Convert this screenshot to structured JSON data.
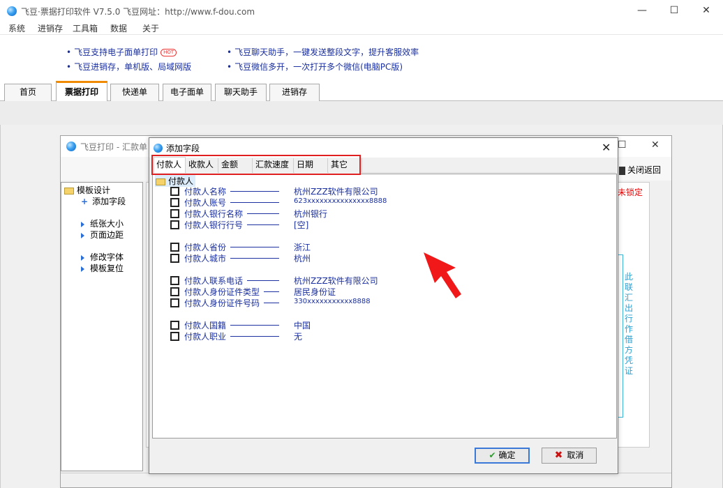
{
  "window": {
    "title": "飞豆·票据打印软件 V7.5.0   飞豆网址：http://www.f-dou.com",
    "controls": {
      "minimize": "—",
      "maximize": "☐",
      "close": "✕"
    }
  },
  "menu": [
    "系统",
    "进销存",
    "工具箱",
    "数据",
    "关于"
  ],
  "promo": {
    "hot_badge": "HOT",
    "items": [
      "飞豆支持电子面单打印",
      "飞豆聊天助手，一键发送整段文字，提升客服效率",
      "飞豆进销存，单机版、局域网版",
      "飞豆微信多开，一次打开多个微信(电脑PC版)"
    ]
  },
  "main_tabs": [
    "首页",
    "票据打印",
    "快递单",
    "电子面单",
    "聊天助手",
    "进销存"
  ],
  "child_window": {
    "title": "飞豆打印 - 汇款单",
    "close_return": "关闭返回",
    "status_unlocked": "未锁定",
    "vertical_text": "此联汇出行作借方凭证",
    "tree": {
      "root": "模板设计",
      "items": [
        "添加字段",
        "纸张大小",
        "页面边距",
        "修改字体",
        "模板复位"
      ]
    }
  },
  "dialog": {
    "title": "添加字段",
    "tabs": [
      "付款人",
      "收款人",
      "金额",
      "汇款速度",
      "日期",
      "其它"
    ],
    "group": "付款人",
    "fields": [
      {
        "name": "付款人名称",
        "value": "杭州ZZZ软件有限公司"
      },
      {
        "name": "付款人账号",
        "value": "623xxxxxxxxxxxxxxx8888"
      },
      {
        "name": "付款人银行名称",
        "value": "杭州银行"
      },
      {
        "name": "付款人银行行号",
        "value": "[空]"
      },
      {
        "name": "付款人省份",
        "value": "浙江"
      },
      {
        "name": "付款人城市",
        "value": "杭州"
      },
      {
        "name": "付款人联系电话",
        "value": "杭州ZZZ软件有限公司"
      },
      {
        "name": "付款人身份证件类型",
        "value": "居民身份证"
      },
      {
        "name": "付款人身份证件号码",
        "value": "330xxxxxxxxxxx8888"
      },
      {
        "name": "付款人国籍",
        "value": "中国"
      },
      {
        "name": "付款人职业",
        "value": "无"
      }
    ],
    "ok_label": "确定",
    "cancel_label": "取消"
  },
  "colors": {
    "accent_tab": "#f08a00",
    "link_blue": "#1a2fa0",
    "highlight_red": "#e02020"
  }
}
